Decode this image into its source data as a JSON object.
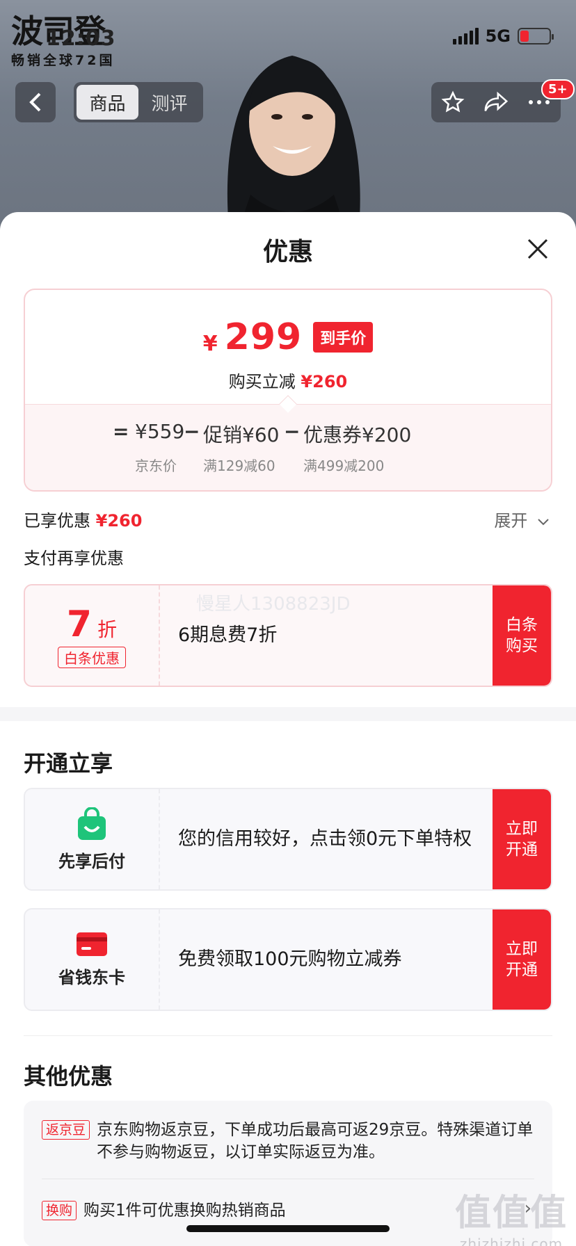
{
  "status_bar": {
    "time": "12:03",
    "network": "5G"
  },
  "brand": {
    "name": "波司登",
    "slogan": "畅销全球72国"
  },
  "nav": {
    "back_icon": "chevron-left-icon",
    "tabs": [
      {
        "label": "商品",
        "active": true
      },
      {
        "label": "测评",
        "active": false
      }
    ],
    "actions": [
      "star-icon",
      "share-icon",
      "more-icon"
    ],
    "more_badge": "5+"
  },
  "sheet": {
    "title": "优惠",
    "price_card": {
      "currency": "¥",
      "final_price": "299",
      "final_tag": "到手价",
      "saving_label": "购买立减",
      "saving_value": "¥260",
      "formula": {
        "eq": "=",
        "base_price": "¥559",
        "base_label": "京东价",
        "minus": "−",
        "promo": "促销¥60",
        "promo_label": "满129减60",
        "coupon": "优惠券¥200",
        "coupon_label": "满499减200"
      }
    },
    "enjoyed": {
      "label": "已享优惠",
      "value": "¥260",
      "expand": "展开"
    },
    "pay_more_title": "支付再享优惠",
    "baitiao": {
      "discount_num": "7",
      "discount_unit": "折",
      "tag": "白条优惠",
      "text": "6期息费7折",
      "watermark": "慢星人1308823JD",
      "action": "白条购买"
    },
    "open_section_title": "开通立享",
    "open_items": [
      {
        "icon": "shopping-bag-icon",
        "label": "先享后付",
        "text": "您的信用较好，点击领0元下单特权",
        "action": "立即开通"
      },
      {
        "icon": "card-icon",
        "label": "省钱东卡",
        "text": "免费领取100元购物立减券",
        "action": "立即开通"
      }
    ],
    "other_section_title": "其他优惠",
    "other_items": [
      {
        "tag": "返京豆",
        "text": "京东购物返京豆，下单成功后最高可返29京豆。特殊渠道订单不参与购物返豆，以订单实际返豆为准。"
      },
      {
        "tag": "换购",
        "text": "购买1件可优惠换购热销商品"
      }
    ]
  },
  "watermark": {
    "main": "值值值",
    "sub": "zhizhizhi.com"
  },
  "colors": {
    "accent": "#f0242f",
    "tag_bg": "#f0242f"
  }
}
